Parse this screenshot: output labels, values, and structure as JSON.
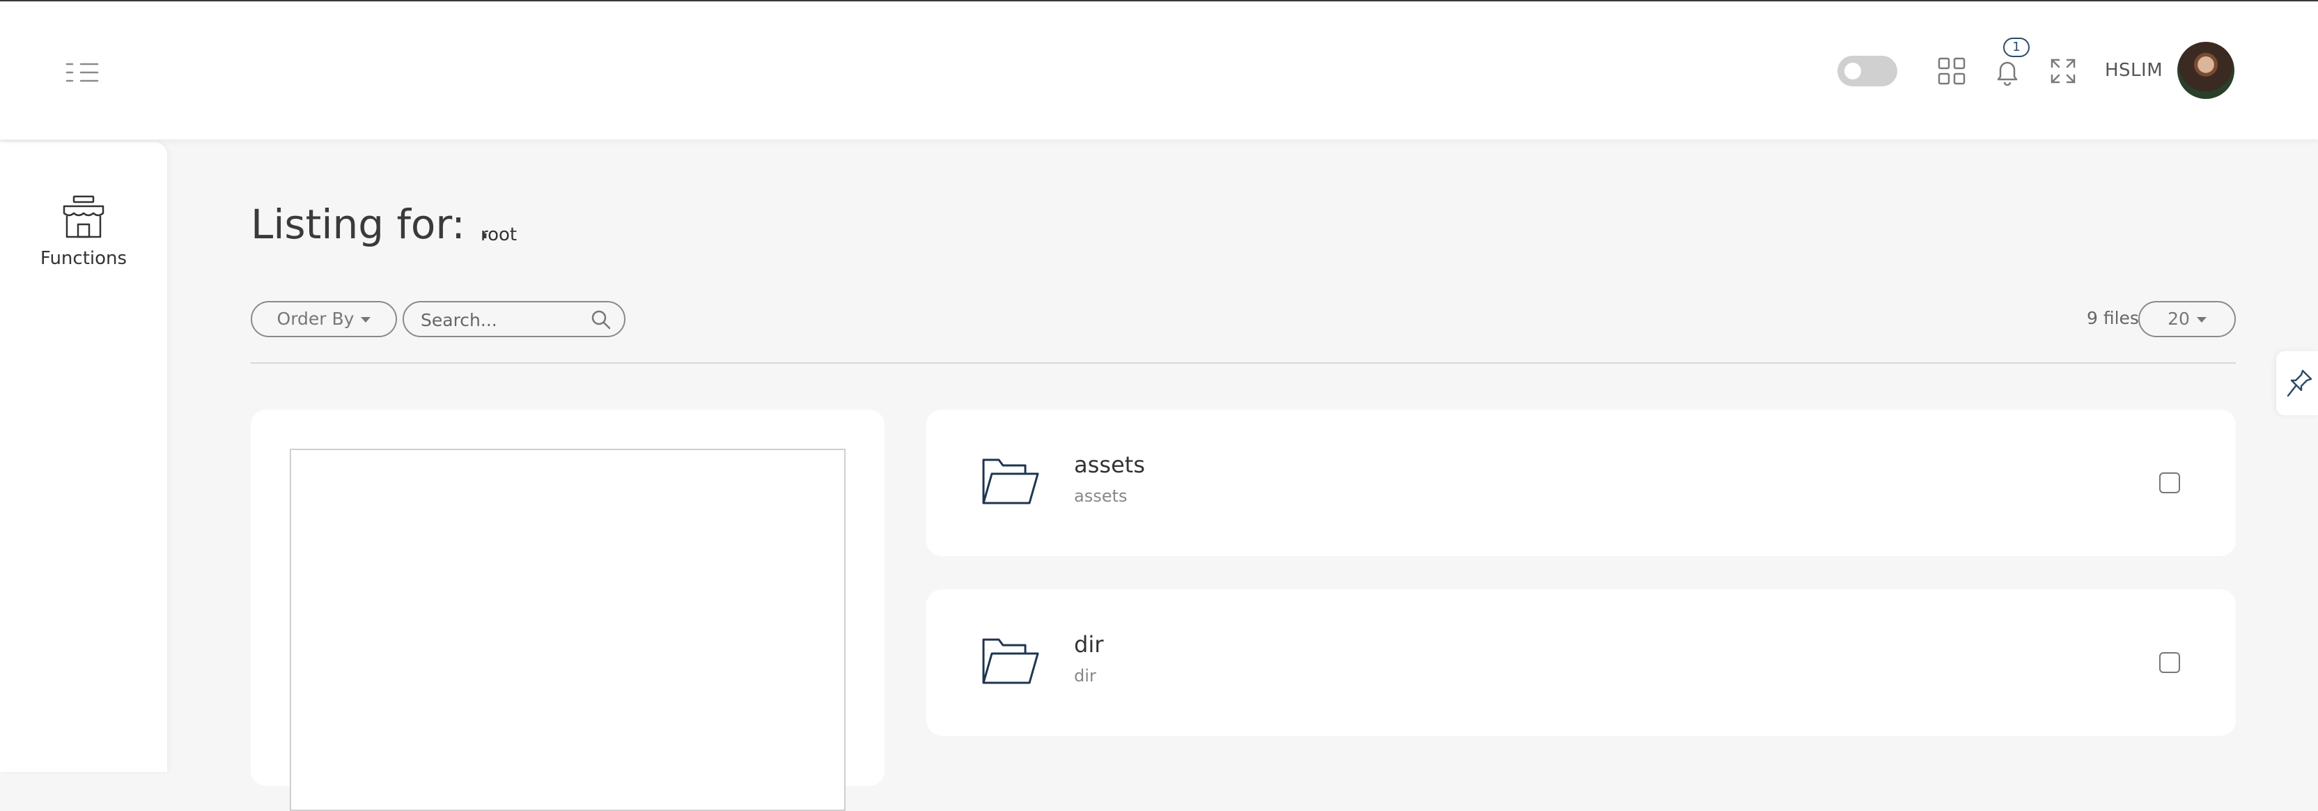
{
  "header": {
    "username": "HSLIM",
    "notification_count": "1",
    "theme_toggle_on": false,
    "icons": [
      "menu-toggle-icon",
      "apps-grid-icon",
      "bell-icon",
      "fullscreen-icon"
    ]
  },
  "sidebar": {
    "items": [
      {
        "label": "Functions",
        "icon": "shop-icon"
      }
    ]
  },
  "main": {
    "title": "Listing for: .",
    "path_label": "root",
    "toolbar": {
      "order_by_label": "Order By",
      "search_placeholder": "Search...",
      "file_count": "9 files",
      "page_size": "20"
    },
    "files": [
      {
        "name": "assets",
        "subtitle": "assets",
        "icon": "folder-icon",
        "checked": false
      },
      {
        "name": "dir",
        "subtitle": "dir",
        "icon": "folder-icon",
        "checked": false
      }
    ]
  },
  "colors": {
    "accent": "#2d4a6a",
    "background": "#f6f6f6",
    "card": "#ffffff"
  }
}
